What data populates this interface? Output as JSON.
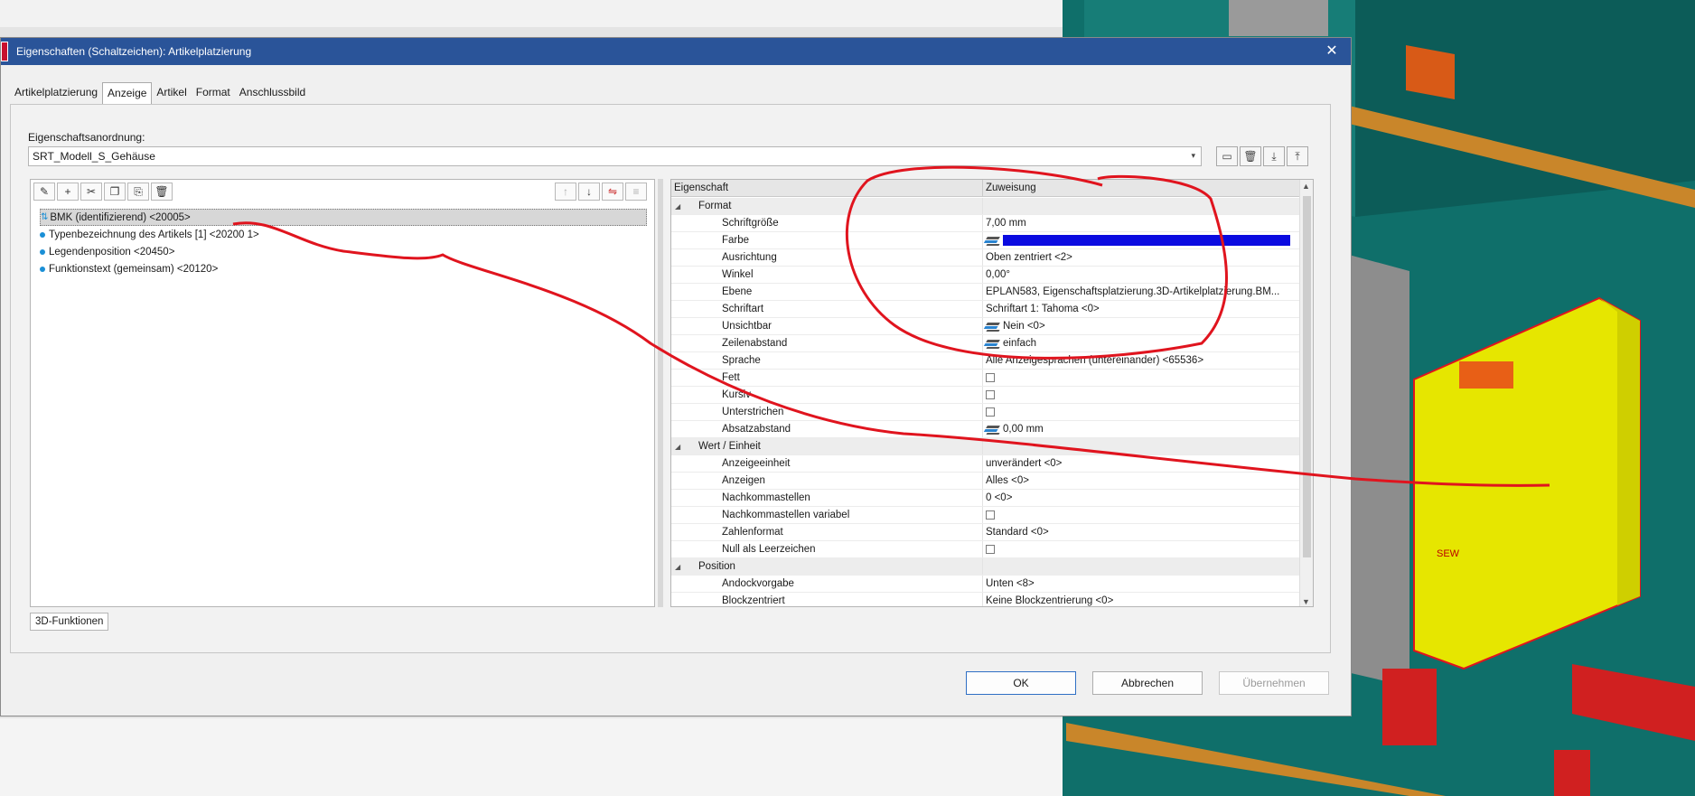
{
  "dialog": {
    "title": "Eigenschaften (Schaltzeichen): Artikelplatzierung",
    "close_glyph": "✕",
    "tabs": [
      "Artikelplatzierung",
      "Anzeige",
      "Artikel",
      "Format",
      "Anschlussbild"
    ],
    "active_tab": "Anzeige",
    "arrangement_label": "Eigenschaftsanordnung:",
    "arrangement_value": "SRT_Modell_S_Gehäuse",
    "tree": [
      "BMK (identifizierend) <20005>",
      "Typenbezeichnung des Artikels [1] <20200 1>",
      "Legendenposition <20450>",
      "Funktionstext (gemeinsam) <20120>"
    ],
    "grid_headers": {
      "property": "Eigenschaft",
      "assignment": "Zuweisung"
    },
    "grid_rows": [
      {
        "group": true,
        "name": "Format"
      },
      {
        "name": "Schriftgröße",
        "value": "7,00 mm"
      },
      {
        "name": "Farbe",
        "value": "",
        "swatch": "#0a0ae0"
      },
      {
        "name": "Ausrichtung",
        "value": "Oben zentriert <2>"
      },
      {
        "name": "Winkel",
        "value": "0,00°"
      },
      {
        "name": "Ebene",
        "value": "EPLAN583, Eigenschaftsplatzierung.3D-Artikelplatzierung.BM..."
      },
      {
        "name": "Schriftart",
        "value": "Schriftart 1: Tahoma <0>"
      },
      {
        "name": "Unsichtbar",
        "value": "Nein <0>",
        "layers": true
      },
      {
        "name": "Zeilenabstand",
        "value": "einfach",
        "layers": true
      },
      {
        "name": "Sprache",
        "value": "Alle Anzeigesprachen (untereinander) <65536>"
      },
      {
        "name": "Fett",
        "checkbox": true
      },
      {
        "name": "Kursiv",
        "checkbox": true
      },
      {
        "name": "Unterstrichen",
        "checkbox": true
      },
      {
        "name": "Absatzabstand",
        "value": "0,00 mm",
        "layers": true
      },
      {
        "group": true,
        "name": "Wert / Einheit"
      },
      {
        "name": "Anzeigeeinheit",
        "value": "unverändert <0>"
      },
      {
        "name": "Anzeigen",
        "value": "Alles <0>"
      },
      {
        "name": "Nachkommastellen",
        "value": "0 <0>"
      },
      {
        "name": "Nachkommastellen variabel",
        "checkbox": true
      },
      {
        "name": "Zahlenformat",
        "value": "Standard <0>"
      },
      {
        "name": "Null als Leerzeichen",
        "checkbox": true
      },
      {
        "group": true,
        "name": "Position"
      },
      {
        "name": "Andockvorgabe",
        "value": "Unten <8>"
      },
      {
        "name": "Blockzentriert",
        "value": "Keine Blockzentrierung <0>"
      }
    ],
    "bottom_tab": "3D-Funktionen",
    "buttons": {
      "ok": "OK",
      "cancel": "Abbrechen",
      "apply": "Übernehmen"
    },
    "bg_label": "SEW"
  },
  "colors": {
    "titlebar": "#2a5499",
    "annotation": "#e0141e",
    "module_yellow": "#e6e600",
    "cabinet_teal": "#0f6f6a"
  }
}
